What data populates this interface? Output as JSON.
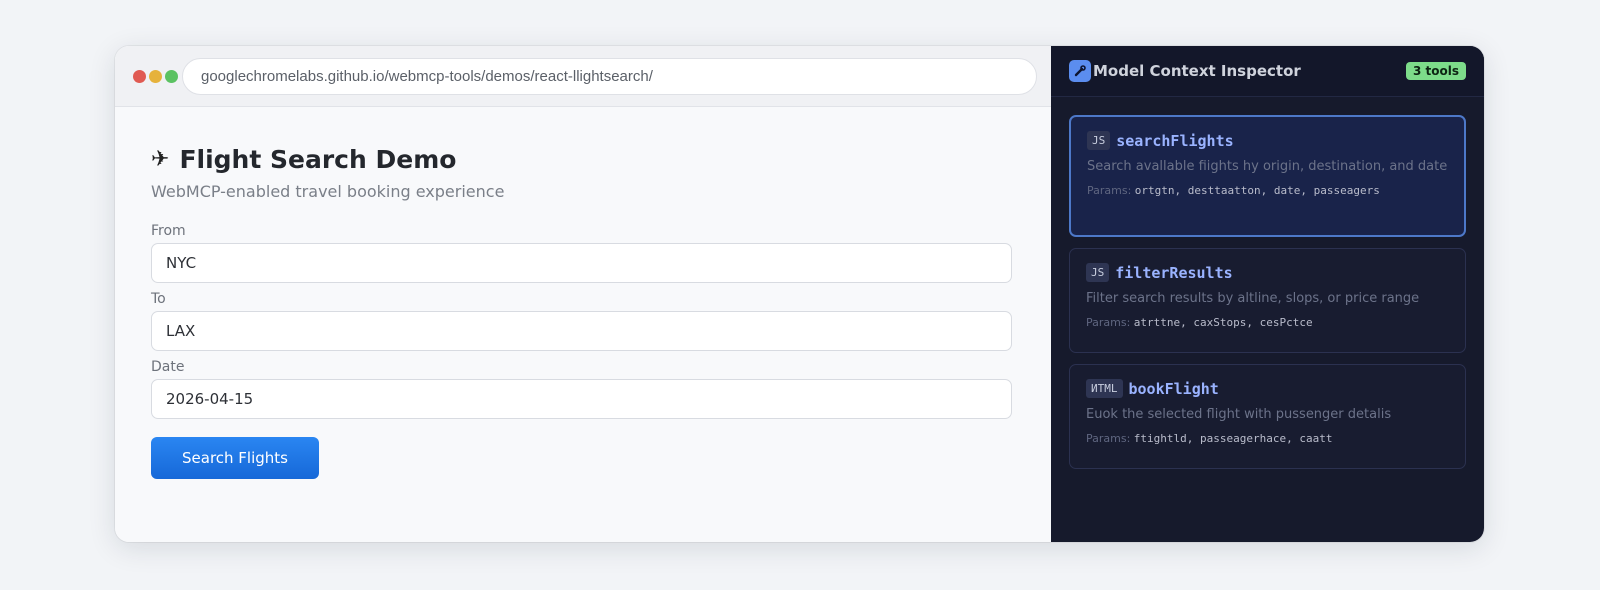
{
  "browser": {
    "url": "googlechromelabs.github.io/webmcp-tools/demos/react-llightsearch/",
    "dots": [
      "#e05a52",
      "#e6b23c",
      "#5bc262"
    ]
  },
  "page": {
    "icon": "airplane-icon",
    "icon_glyph": "✈",
    "title": "Flight Search Demo",
    "subtitle": "WebMCP-enabled travel booking experience",
    "form": {
      "from_label": "From",
      "from_value": "NYC",
      "to_label": "To",
      "to_value": "LAX",
      "date_label": "Date",
      "date_value": "2026-04-15",
      "search_label": "Search Flights"
    }
  },
  "inspector": {
    "icon": "wrench-icon",
    "icon_glyph": "🔧",
    "title": "Model Context Inspector",
    "badge": "3 tools",
    "params_label": "Params:",
    "tools": [
      {
        "type": "JS",
        "name": "searchFlights",
        "description": "Search avallable fiights hy origin, destination, and date",
        "params": "ortgtn, desttaatton, date, passeagers"
      },
      {
        "type": "JS",
        "name": "filterResults",
        "description": "Filter search results by altline, slops, or price range",
        "params": "atrttne, caxStops, cesPctce"
      },
      {
        "type": "ИTML",
        "name": "bookFlight",
        "description": "Euok the selected flight with pussenger detalis",
        "params": "ftightld, passeagerhace, caatt"
      }
    ]
  }
}
